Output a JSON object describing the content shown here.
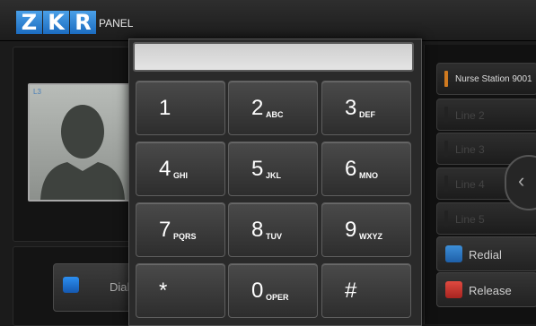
{
  "header": {
    "logo_letters": [
      "Z",
      "K",
      "R"
    ],
    "title": "PANEL"
  },
  "contact": {
    "tag": "L3"
  },
  "dial_button": {
    "label": "Dial",
    "icon": "phone-book-icon"
  },
  "dialpad": {
    "display_value": "",
    "keys": [
      {
        "digit": "1",
        "letters": ""
      },
      {
        "digit": "2",
        "letters": "ABC"
      },
      {
        "digit": "3",
        "letters": "DEF"
      },
      {
        "digit": "4",
        "letters": "GHI"
      },
      {
        "digit": "5",
        "letters": "JKL"
      },
      {
        "digit": "6",
        "letters": "MNO"
      },
      {
        "digit": "7",
        "letters": "PQRS"
      },
      {
        "digit": "8",
        "letters": "TUV"
      },
      {
        "digit": "9",
        "letters": "WXYZ"
      },
      {
        "digit": "*",
        "letters": ""
      },
      {
        "digit": "0",
        "letters": "OPER"
      },
      {
        "digit": "#",
        "letters": ""
      }
    ]
  },
  "lines": [
    {
      "label": "Nurse Station 9001",
      "active": true
    },
    {
      "label": "Line 2",
      "active": false
    },
    {
      "label": "Line 3",
      "active": false
    },
    {
      "label": "Line 4",
      "active": false
    },
    {
      "label": "Line 5",
      "active": false
    }
  ],
  "actions": {
    "redial": "Redial",
    "release": "Release"
  },
  "colors": {
    "logo_blue": "#2a7fd4",
    "active_line_indicator": "#d07a20",
    "release_red": "#c0302a"
  }
}
